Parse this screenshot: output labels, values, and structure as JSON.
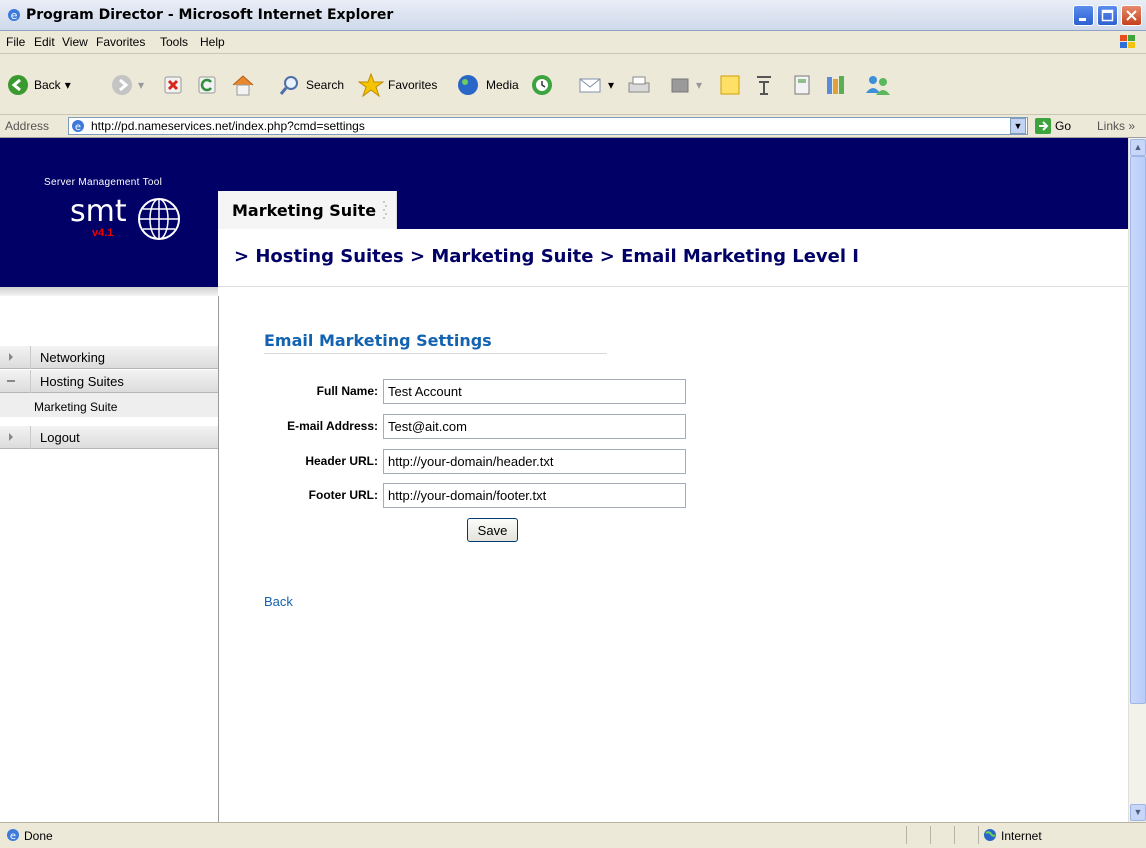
{
  "window": {
    "title": "Program Director - Microsoft Internet Explorer"
  },
  "menu": [
    "File",
    "Edit",
    "View",
    "Favorites",
    "Tools",
    "Help"
  ],
  "toolbar": {
    "back": "Back",
    "search": "Search",
    "favorites": "Favorites",
    "media": "Media"
  },
  "address": {
    "label": "Address",
    "url": "http://pd.nameservices.net/index.php?cmd=settings",
    "go": "Go",
    "links": "Links"
  },
  "brand": {
    "tagline": "Server Management Tool",
    "name": "smt",
    "version": "v4.1"
  },
  "suite_tab": "Marketing Suite",
  "breadcrumb": "> Hosting Suites > Marketing Suite > Email Marketing Level I",
  "sidebar": {
    "items": [
      {
        "label": "Networking"
      },
      {
        "label": "Hosting Suites"
      },
      {
        "label": "Marketing Suite"
      },
      {
        "label": "Logout"
      }
    ]
  },
  "form": {
    "title": "Email Marketing Settings",
    "fields": [
      {
        "label": "Full Name:",
        "value": "Test Account"
      },
      {
        "label": "E-mail Address:",
        "value": "Test@ait.com"
      },
      {
        "label": "Header URL:",
        "value": "http://your-domain/header.txt"
      },
      {
        "label": "Footer URL:",
        "value": "http://your-domain/footer.txt"
      }
    ],
    "save": "Save",
    "back": "Back"
  },
  "status": {
    "text": "Done",
    "zone": "Internet"
  }
}
